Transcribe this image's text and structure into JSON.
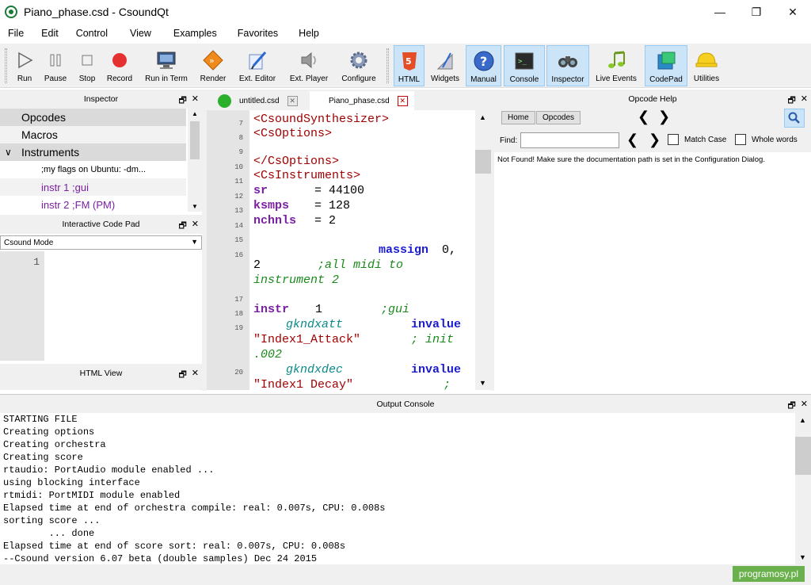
{
  "window": {
    "title": "Piano_phase.csd - CsoundQt",
    "controls": [
      "—",
      "❐",
      "✕"
    ]
  },
  "menu": [
    "File",
    "Edit",
    "Control",
    "View",
    "Examples",
    "Favorites",
    "Help"
  ],
  "toolbar": {
    "run": "Run",
    "pause": "Pause",
    "stop": "Stop",
    "record": "Record",
    "run_in_term": "Run in Term",
    "render": "Render",
    "ext_editor": "Ext. Editor",
    "ext_player": "Ext. Player",
    "configure": "Configure",
    "html": "HTML",
    "widgets": "Widgets",
    "manual": "Manual",
    "console": "Console",
    "inspector": "Inspector",
    "live_events": "Live Events",
    "codepad": "CodePad",
    "utilities": "Utilities"
  },
  "inspector": {
    "title": "Inspector",
    "items": [
      {
        "label": "Opcodes"
      },
      {
        "label": "Macros"
      },
      {
        "label": "Instruments"
      }
    ],
    "children": [
      ";my flags on Ubuntu: -dm...",
      "instr 1 ;gui",
      "instr 2 ;FM (PM)"
    ],
    "expand_arrow": "∨"
  },
  "codepad": {
    "title": "Interactive Code Pad",
    "mode": "Csound Mode",
    "line": "1"
  },
  "htmlview": {
    "title": "HTML View"
  },
  "editor": {
    "tabs": [
      {
        "label": "untitled.csd"
      },
      {
        "label": "Piano_phase.csd"
      }
    ],
    "line_numbers": [
      "7",
      "8",
      "9",
      "10",
      "11",
      "12",
      "13",
      "14",
      "15",
      "16",
      "17",
      "18",
      "19",
      "20"
    ],
    "lines": {
      "l7": "<CsoundSynthesizer>",
      "l8": "<CsOptions>",
      "l10a": "</CsOptions>",
      "l10b": "<CsInstruments>",
      "l11": "sr",
      "l11v": "= 44100",
      "l12": "ksmps",
      "l12v": "= 128",
      "l13": "nchnls",
      "l13v": "= 2",
      "l16_op": "massign",
      "l16_args": "0,",
      "l16_cont": "2",
      "l16_cm": ";all midi to",
      "l16_cm2": "instrument 2",
      "l18_kw": "instr",
      "l18_n": "1",
      "l18_cm": ";gui",
      "l19_var": "gkndxatt",
      "l19_op": "invalue",
      "l19_str": "\"Index1_Attack\"",
      "l19_cm": "; init",
      "l19_cm2": ".002",
      "l20_var": "gkndxdec",
      "l20_op": "invalue",
      "l20_str": "\"Index1 Decay\"",
      "l20_cm": ";"
    }
  },
  "help": {
    "title": "Opcode Help",
    "home": "Home",
    "opcodes": "Opcodes",
    "find": "Find:",
    "match_case": "Match Case",
    "whole_words": "Whole words",
    "message": "Not Found! Make sure the documentation path is set in the Configuration Dialog."
  },
  "console": {
    "title": "Output Console",
    "lines": [
      "STARTING FILE",
      "Creating options",
      "Creating orchestra",
      "Creating score",
      "rtaudio: PortAudio module enabled ...",
      "using blocking interface",
      "rtmidi: PortMIDI module enabled",
      "Elapsed time at end of orchestra compile: real: 0.007s, CPU: 0.008s",
      "sorting score ...",
      "        ... done",
      "Elapsed time at end of score sort: real: 0.007s, CPU: 0.008s",
      "--Csound version 6.07 beta (double samples) Dec 24 2015"
    ]
  },
  "watermark": "programosy.pl",
  "dock_buttons": {
    "float": "🗗",
    "close": "✕"
  },
  "colors": {
    "keyword": "#7a1fa2",
    "tag": "#a00000",
    "opcode": "#1a1ad0",
    "comment": "#1a8a1a",
    "variable": "#0a8a8a"
  }
}
